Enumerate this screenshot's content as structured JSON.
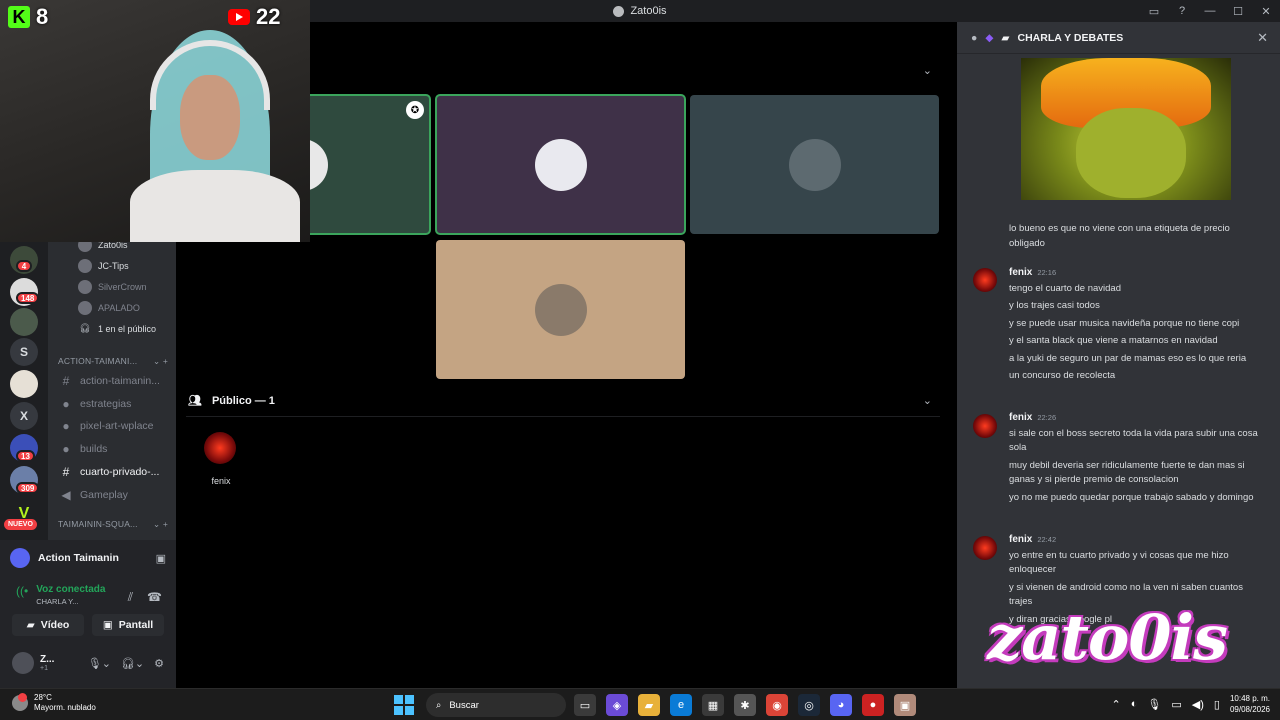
{
  "window": {
    "title": "Zato0is",
    "controls": [
      "▭",
      "?",
      "—",
      "☐",
      "✕"
    ]
  },
  "overlay": {
    "kick_count": "8",
    "youtube_count": "22"
  },
  "server_rail": {
    "items": [
      {
        "label": "",
        "badge": "4"
      },
      {
        "label": "",
        "badge": "148"
      },
      {
        "label": "",
        "badge": ""
      },
      {
        "label": "S",
        "badge": ""
      },
      {
        "label": "",
        "badge": ""
      },
      {
        "label": "X",
        "badge": ""
      },
      {
        "label": "",
        "badge": "13"
      },
      {
        "label": "",
        "badge": "309"
      },
      {
        "label": "V",
        "badge": ""
      }
    ],
    "new_label": "NUEVO"
  },
  "voice_users": [
    {
      "name": "Zato0is",
      "dim": false
    },
    {
      "name": "JC-Tips",
      "dim": false
    },
    {
      "name": "SilverCrown",
      "dim": true
    },
    {
      "name": "APALADO",
      "dim": true
    }
  ],
  "audience_label": "1 en el público",
  "categories": {
    "action": "ACTION-TAIMANI...",
    "squad": "TAIMAININ-SQUA..."
  },
  "channels": [
    {
      "name": "action-taimanin...",
      "icon": "#",
      "active": false
    },
    {
      "name": "estrategias",
      "icon": "forum",
      "active": false
    },
    {
      "name": "pixel-art-wplace",
      "icon": "forum",
      "active": false
    },
    {
      "name": "builds",
      "icon": "forum",
      "active": false
    },
    {
      "name": "cuarto-privado-...",
      "icon": "#",
      "active": true
    },
    {
      "name": "Gameplay",
      "icon": "voice",
      "active": false
    }
  ],
  "user_panel": {
    "server_name": "Action Taimanin",
    "voice_status": "Voz conectada",
    "voice_channel": "CHARLA Y...",
    "video_label": "Vídeo",
    "screen_label": "Pantall",
    "username": "Z...",
    "user_sub": "+1"
  },
  "stage": {
    "tiles": [
      {
        "bg": "#2f4a3e",
        "speaking": true,
        "moderator": true
      },
      {
        "bg": "#3f3148",
        "speaking": true,
        "moderator": false
      },
      {
        "bg": "#36454b",
        "speaking": false,
        "moderator": false
      },
      {
        "bg": "#c4a483",
        "speaking": false,
        "moderator": false
      }
    ],
    "public_header": "Público — 1",
    "public_user": "fenix"
  },
  "chat": {
    "title": "CHARLA Y DEBATES",
    "first_text": [
      "lo bueno es que no viene con una etiqueta de precio obligado"
    ],
    "messages": [
      {
        "author": "fenix",
        "time": "22:16",
        "lines": [
          "tengo el cuarto de navidad",
          "y los trajes casi todos",
          "y se puede usar musica navideña porque no tiene copi",
          "y el santa black que viene a matarnos en navidad",
          "a la yuki de seguro un par de mamas eso es lo que reria",
          "un concurso de recolecta"
        ]
      },
      {
        "author": "fenix",
        "time": "22:26",
        "lines": [
          "si sale con el boss secreto toda la vida para subir una cosa sola",
          "muy debil deveria ser ridiculamente fuerte te dan mas si ganas y si pierde premio de consolacion",
          "yo no me puedo quedar porque trabajo sabado y domingo"
        ]
      },
      {
        "author": "fenix",
        "time": "22:42",
        "lines": [
          "yo entre en tu cuarto privado y vi cosas que me hizo enloquecer",
          "y si vienen de android como no la ven ni saben cuantos trajes",
          "y diran gracias google pl"
        ]
      }
    ]
  },
  "watermark": "zato0is",
  "taskbar": {
    "temperature": "28°C",
    "weather": "Mayorm. nublado",
    "search": "Buscar",
    "time": "10:48 p. m.",
    "date": "09/08/2026"
  },
  "colors": {
    "speaking": "#3ba55c",
    "voice_green": "#23a55a",
    "badge_red": "#f23f43",
    "watermark_pink": "#c43bbd"
  }
}
